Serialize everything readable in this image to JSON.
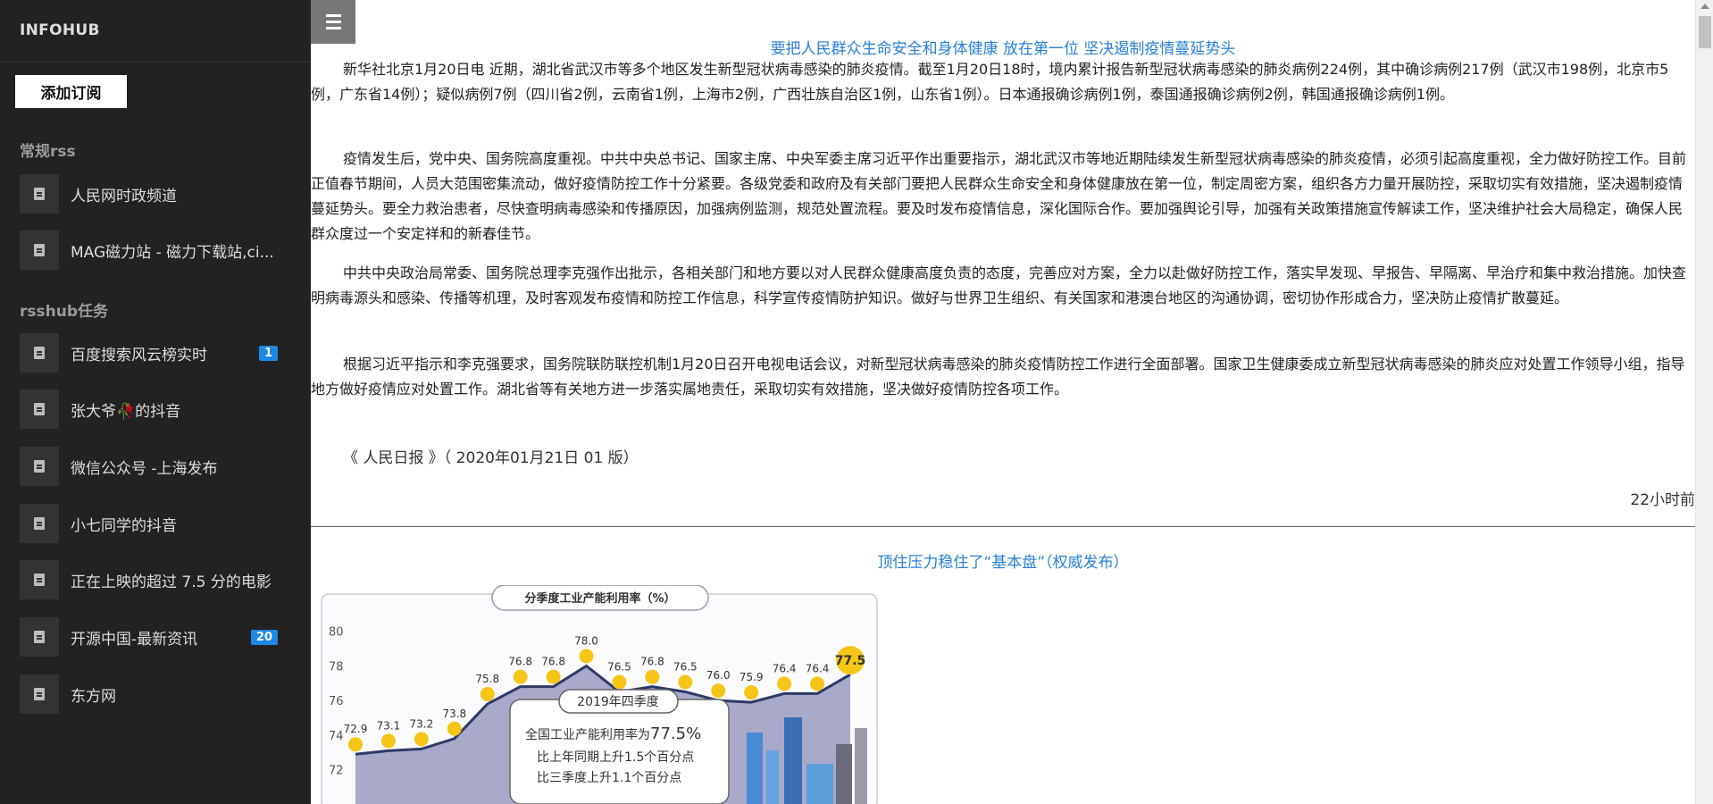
{
  "sidebar": {
    "brand": "INFOHUB",
    "add_button": "添加订阅",
    "groups": [
      {
        "title": "常规rss",
        "items": [
          {
            "label": "人民网时政频道",
            "badge": ""
          },
          {
            "label": "MAG磁力站 - 磁力下载站,ci...",
            "badge": ""
          }
        ]
      },
      {
        "title": "rsshub任务",
        "items": [
          {
            "label": "百度搜索风云榜实时",
            "badge": "1"
          },
          {
            "label": "张大爷🥀的抖音",
            "badge": ""
          },
          {
            "label": "微信公众号 -上海发布",
            "badge": ""
          },
          {
            "label": "小七同学的抖音",
            "badge": ""
          },
          {
            "label": "正在上映的超过 7.5 分的电影",
            "badge": ""
          },
          {
            "label": "开源中国-最新资讯",
            "badge": "20"
          },
          {
            "label": "东方网",
            "badge": ""
          }
        ]
      }
    ]
  },
  "articles": [
    {
      "title": "要把人民群众生命安全和身体健康 放在第一位 坚决遏制疫情蔓延势头",
      "paragraphs": [
        "新华社北京1月20日电  近期，湖北省武汉市等多个地区发生新型冠状病毒感染的肺炎疫情。截至1月20日18时，境内累计报告新型冠状病毒感染的肺炎病例224例，其中确诊病例217例（武汉市198例，北京市5例，广东省14例）；疑似病例7例（四川省2例，云南省1例，上海市2例，广西壮族自治区1例，山东省1例）。日本通报确诊病例1例，泰国通报确诊病例2例，韩国通报确诊病例1例。",
        "疫情发生后，党中央、国务院高度重视。中共中央总书记、国家主席、中央军委主席习近平作出重要指示，湖北武汉市等地近期陆续发生新型冠状病毒感染的肺炎疫情，必须引起高度重视，全力做好防控工作。目前正值春节期间，人员大范围密集流动，做好疫情防控工作十分紧要。各级党委和政府及有关部门要把人民群众生命安全和身体健康放在第一位，制定周密方案，组织各方力量开展防控，采取切实有效措施，坚决遏制疫情蔓延势头。要全力救治患者，尽快查明病毒感染和传播原因，加强病例监测，规范处置流程。要及时发布疫情信息，深化国际合作。要加强舆论引导，加强有关政策措施宣传解读工作，坚决维护社会大局稳定，确保人民群众度过一个安定祥和的新春佳节。",
        "中共中央政治局常委、国务院总理李克强作出批示，各相关部门和地方要以对人民群众健康高度负责的态度，完善应对方案，全力以赴做好防控工作，落实早发现、早报告、早隔离、早治疗和集中救治措施。加快查明病毒源头和感染、传播等机理，及时客观发布疫情和防控工作信息，科学宣传疫情防护知识。做好与世界卫生组织、有关国家和港澳台地区的沟通协调，密切协作形成合力，坚决防止疫情扩散蔓延。",
        "根据习近平指示和李克强要求，国务院联防联控机制1月20日召开电视电话会议，对新型冠状病毒感染的肺炎疫情防控工作进行全面部署。国家卫生健康委成立新型冠状病毒感染的肺炎应对处置工作领导小组，指导地方做好疫情应对处置工作。湖北省等有关地方进一步落实属地责任，采取切实有效措施，坚决做好疫情防控各项工作。"
      ],
      "source": "《 人民日报 》（ 2020年01月21日 01 版）",
      "time": "22小时前"
    },
    {
      "title": "顶住压力稳住了“基本盘”（权威发布）"
    }
  ],
  "embedded_chart": {
    "title": "分季度工业产能利用率（%）",
    "y_ticks": [
      "80",
      "78",
      "76",
      "74",
      "72"
    ],
    "values": [
      "72.9",
      "73.1",
      "73.2",
      "73.8",
      "75.8",
      "76.8",
      "76.8",
      "78.0",
      "76.5",
      "76.8",
      "76.5",
      "76.0",
      "75.9",
      "76.4",
      "76.4",
      "77.5"
    ],
    "callout_tag": "2019年四季度",
    "callout_line1_prefix": "全国工业产能利用率为",
    "callout_line1_value": "77.5%",
    "callout_line2": "比上年同期上升1.5个百分点",
    "callout_line3": "比三季度上升1.1个百分点"
  }
}
